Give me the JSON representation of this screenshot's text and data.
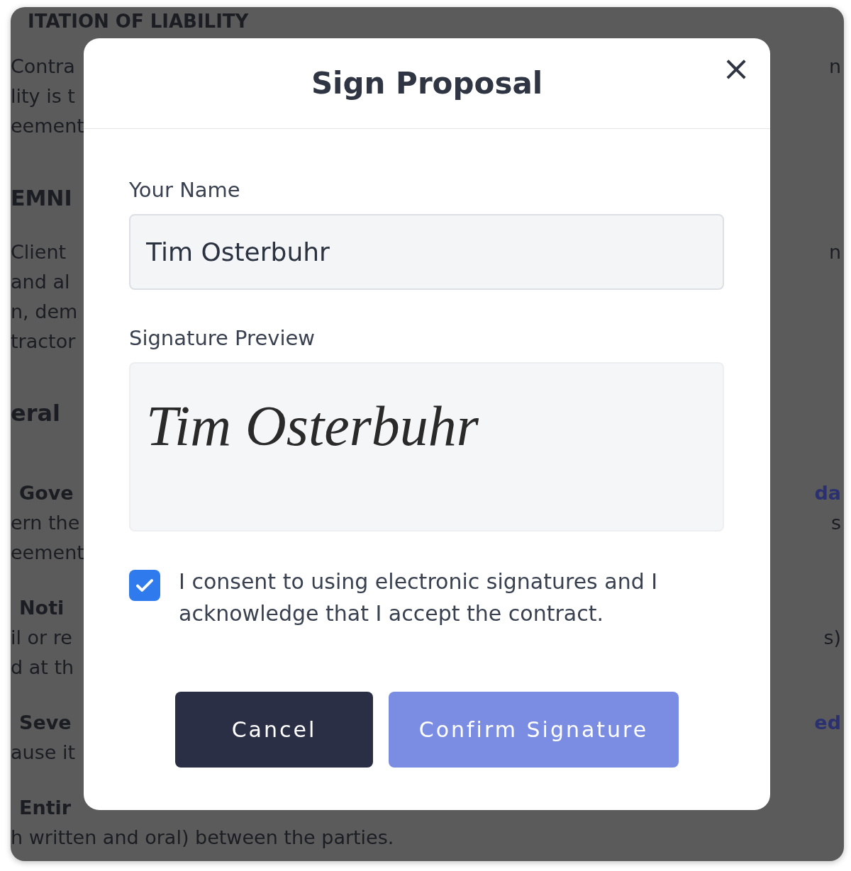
{
  "document": {
    "title": "ITATION OF LIABILITY",
    "lines": [
      {
        "kind": "body",
        "left": "Contra",
        "right": "n"
      },
      {
        "kind": "body",
        "left": "lity is t"
      },
      {
        "kind": "body",
        "left": "eement"
      },
      {
        "kind": "heading",
        "left": "EMNI"
      },
      {
        "kind": "body",
        "left": "Client",
        "right": "n"
      },
      {
        "kind": "body",
        "left": "and al"
      },
      {
        "kind": "body",
        "left": "n, dem"
      },
      {
        "kind": "body",
        "left": "tractor"
      },
      {
        "kind": "section",
        "left": "eral"
      },
      {
        "kind": "subheading",
        "left": "Gove",
        "right": "da"
      },
      {
        "kind": "body",
        "left": "ern the",
        "right": "s"
      },
      {
        "kind": "body",
        "left": "eement"
      },
      {
        "kind": "subheading",
        "left": "Noti"
      },
      {
        "kind": "body",
        "left": "il or re",
        "right": "s)"
      },
      {
        "kind": "body",
        "left": "d at th"
      },
      {
        "kind": "subheading",
        "left": "Seve",
        "right": "ed"
      },
      {
        "kind": "body",
        "left": "ause it"
      },
      {
        "kind": "subheading",
        "left": "Entir"
      }
    ],
    "last_line": "h written and oral) between the parties."
  },
  "dialog": {
    "title": "Sign Proposal",
    "close": "×",
    "name_label": "Your Name",
    "name_value": "Tim Osterbuhr",
    "preview_label": "Signature Preview",
    "signature": "Tim Osterbuhr",
    "consent": {
      "text": "I consent to using electronic signatures and I acknowledge that I accept the contract.",
      "checked": true
    },
    "buttons": [
      {
        "kind": "secondary",
        "label": "Cancel"
      },
      {
        "kind": "primary",
        "label": "Confirm Signature"
      }
    ]
  }
}
